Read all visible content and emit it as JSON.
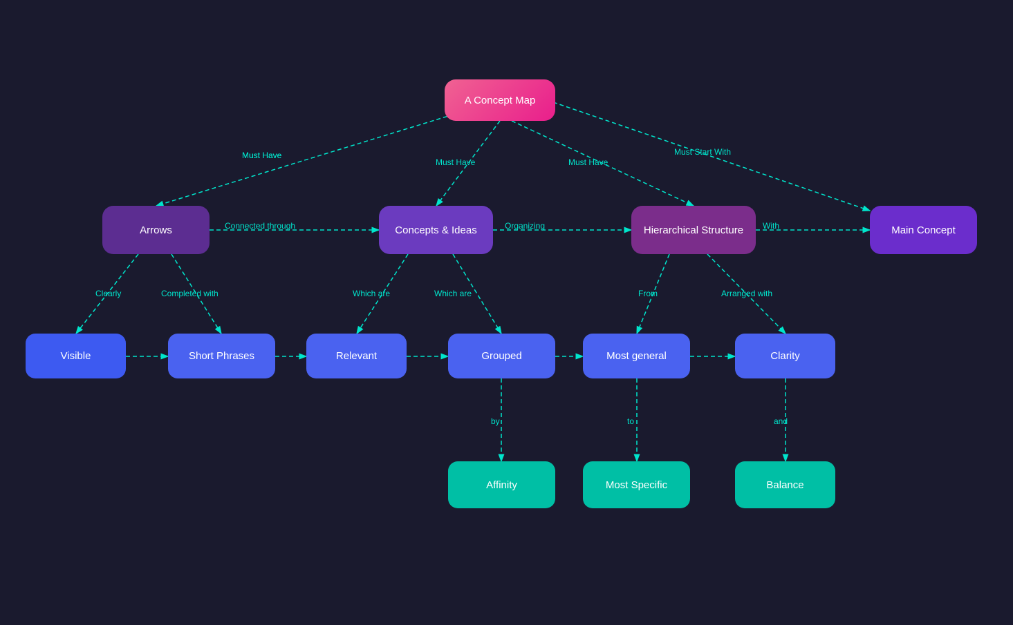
{
  "title": "A Concept Map",
  "nodes": {
    "root": {
      "label": "A Concept Map"
    },
    "arrows": {
      "label": "Arrows"
    },
    "concepts": {
      "label": "Concepts & Ideas"
    },
    "hierarchical": {
      "label": "Hierarchical Structure"
    },
    "main_concept": {
      "label": "Main Concept"
    },
    "visible": {
      "label": "Visible"
    },
    "short_phrases": {
      "label": "Short Phrases"
    },
    "relevant": {
      "label": "Relevant"
    },
    "grouped": {
      "label": "Grouped"
    },
    "most_general": {
      "label": "Most general"
    },
    "clarity": {
      "label": "Clarity"
    },
    "affinity": {
      "label": "Affinity"
    },
    "most_specific": {
      "label": "Most Specific"
    },
    "balance": {
      "label": "Balance"
    }
  },
  "edge_labels": {
    "root_to_arrows": "Must Have",
    "root_to_concepts": "Must Have",
    "root_to_hierarchical": "Must Have",
    "root_to_main": "Must Start With",
    "arrows_to_concepts": "Connected through",
    "concepts_to_hierarchical": "Organizing",
    "hierarchical_to_main": "With",
    "arrows_to_visible": "Clearly",
    "arrows_to_short": "Completed with",
    "concepts_to_relevant": "Which are",
    "concepts_to_grouped": "Which are",
    "hierarchical_to_most_general": "From",
    "hierarchical_to_clarity": "Arranged with",
    "visible_to_short": "",
    "short_to_relevant": "",
    "relevant_to_grouped": "",
    "grouped_to_most_general": "",
    "most_general_to_clarity": "",
    "grouped_to_affinity": "by",
    "most_general_to_most_specific": "to",
    "clarity_to_balance": "and"
  },
  "colors": {
    "background": "#1a1a2e",
    "pink": "#e91e8c",
    "purple_dark": "#5c2d91",
    "purple_mid": "#6b3bbf",
    "blue": "#3d5af1",
    "teal": "#00bfa5",
    "arrow_color": "#00e5cc"
  }
}
